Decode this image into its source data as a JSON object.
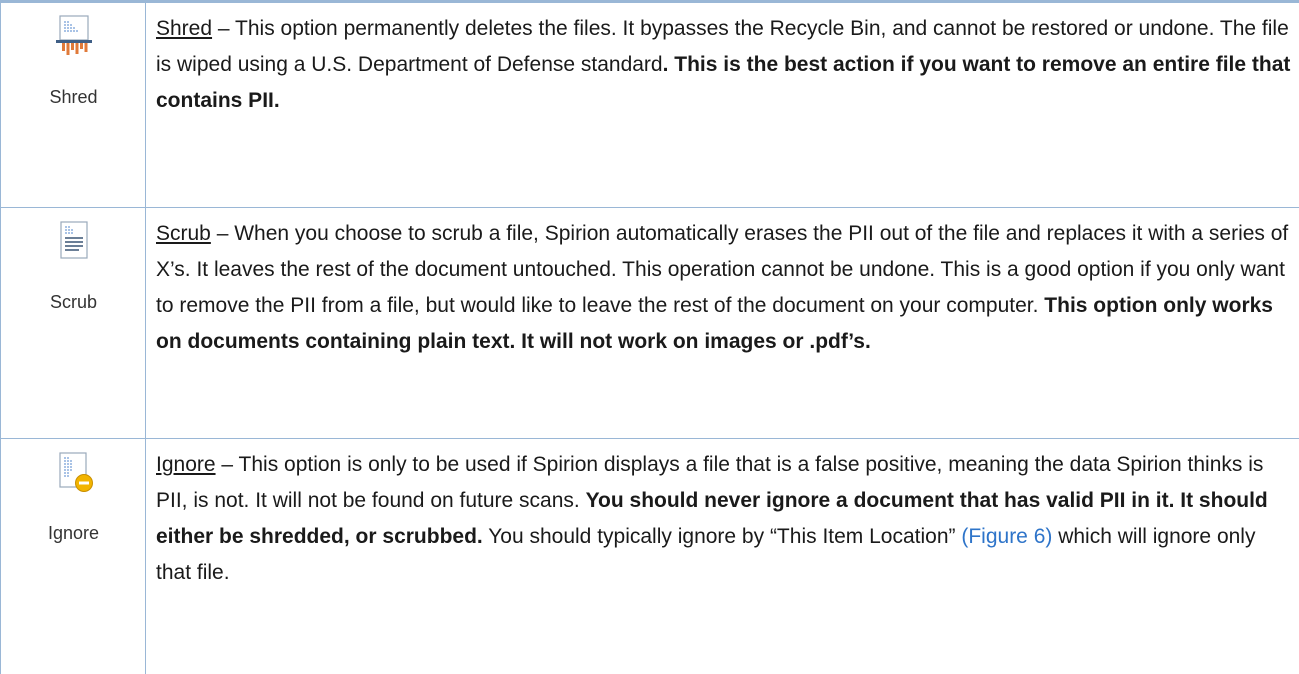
{
  "rows": [
    {
      "icon": "shred-icon",
      "label": "Shred",
      "term": "Shred",
      "dash": " – ",
      "text": "This option permanently deletes the files. It bypasses the Recycle Bin, and cannot be restored or undone. The file is wiped using a U.S. Department of Defense standard",
      "bold": ". This is the best action if you want to remove an entire file that contains PII."
    },
    {
      "icon": "scrub-icon",
      "label": "Scrub",
      "term": "Scrub",
      "dash": " – ",
      "text": "When you choose to scrub a file, Spirion automatically erases the PII out of the file and replaces it with a series of X’s. It leaves the rest of the document untouched. This operation cannot be undone. This is a good option if you only want to remove the PII from a file, but would like to leave the rest of the document on your computer.  ",
      "bold": "This option only works on documents containing plain text. It will not work on images or .pdf’s."
    },
    {
      "icon": "ignore-icon",
      "label": "Ignore",
      "term": "Ignore",
      "dash": " – ",
      "text": "This option is only to be used if Spirion displays a file that is a false positive, meaning the data Spirion thinks is PII, is not. It will not be found on future scans. ",
      "bold": "You should never ignore a document that has valid PII in it. It should either be shredded, or scrubbed.",
      "text2": " You should typically ignore by “This Item Location” ",
      "xref": "(Figure 6)",
      "text3": " which will ignore only that file."
    }
  ],
  "colors": {
    "rule": "#9ab7d6",
    "link": "#2e74c9",
    "shred_strip": "#e07a3a",
    "ignore_badge": "#f2b400"
  }
}
